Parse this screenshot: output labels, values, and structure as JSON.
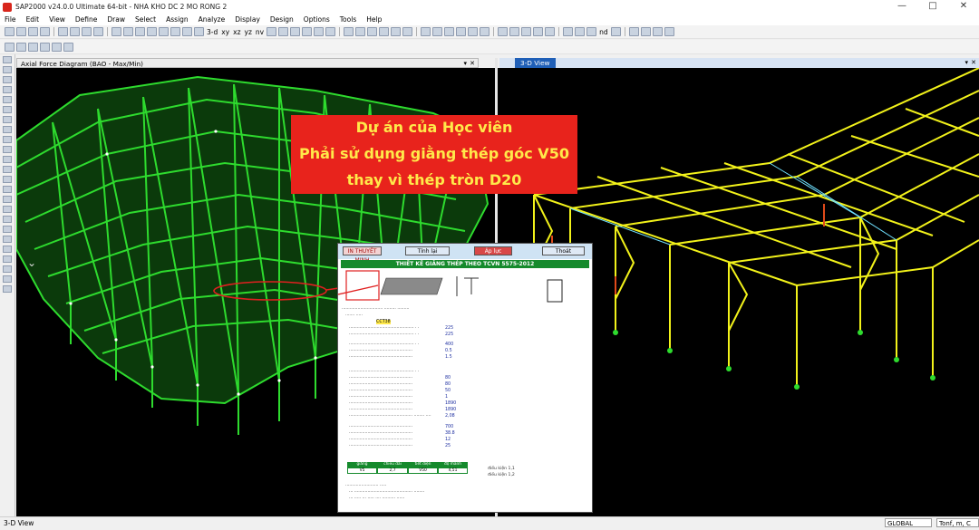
{
  "window": {
    "title": "SAP2000 v24.0.0 Ultimate 64-bit - NHA KHO DC 2 MO RONG 2",
    "controls": [
      "—",
      "□",
      "✕"
    ]
  },
  "menu": [
    "File",
    "Edit",
    "View",
    "Define",
    "Draw",
    "Select",
    "Assign",
    "Analyze",
    "Display",
    "Design",
    "Options",
    "Tools",
    "Help"
  ],
  "toolbar": {
    "view_3d": "3-d",
    "view_xy": "xy",
    "view_xz": "xz",
    "view_yz": "yz",
    "view_nv": "nv",
    "view_nd": "nd"
  },
  "panes": {
    "left_title": "Axial Force Diagram  (BAO - Max/Min)",
    "right_title": "3-D View",
    "pin": "▾",
    "close": "✕",
    "chevron": "⌄"
  },
  "banner": {
    "line1": "Dự án của Học viên",
    "line2": "Phải sử dụng giằng thép góc V50",
    "line3": "thay vì thép tròn D20"
  },
  "sheet": {
    "buttons": [
      "IN THUYẾT MINH",
      "Tính lại",
      "Áp lực",
      "Thoát"
    ],
    "title": "THIẾT KẾ GIẰNG THÉP THEO TCVN 5575-2012",
    "row_values": [
      "CCT38",
      "225",
      "225",
      "400",
      "0.5",
      "1.5",
      "80",
      "80",
      "50",
      "1",
      "1890",
      "1890",
      "2,08",
      "700",
      "38.8",
      "12",
      "25"
    ],
    "table_headers": [
      "giằng",
      "chiều dài",
      "tiết diện",
      "độ mảnh"
    ],
    "table_values": [
      "V5",
      "2,7",
      "V50",
      "4,51"
    ],
    "footer_checks": [
      "điều kiện 1,1",
      "điều kiện 1,2"
    ]
  },
  "status": {
    "left": "3-D View",
    "coord_system": "GLOBAL",
    "units": "Tonf, m, C"
  },
  "colors": {
    "banner_bg": "#e8231c",
    "banner_text": "#ffe94a",
    "left_model": "#2edb2e",
    "right_model": "#f2f21a",
    "sheet_green": "#158a2c"
  }
}
